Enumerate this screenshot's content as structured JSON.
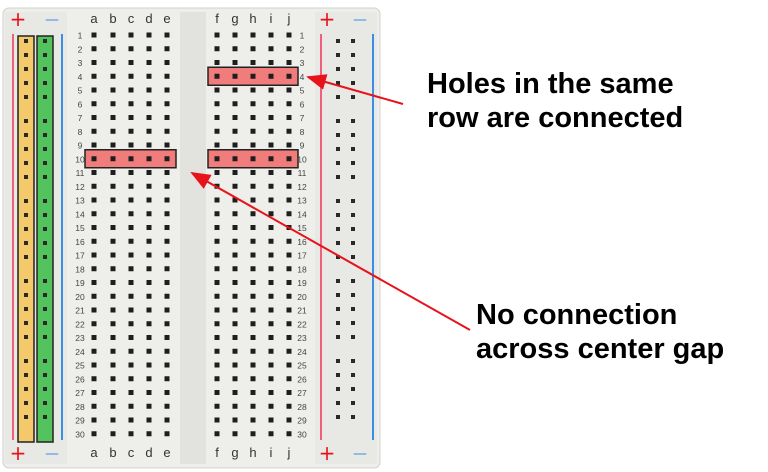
{
  "board": {
    "columns_left": [
      "a",
      "b",
      "c",
      "d",
      "e"
    ],
    "columns_right": [
      "f",
      "g",
      "h",
      "i",
      "j"
    ],
    "rows": 30,
    "rail_plus_symbol": "+",
    "rail_minus_symbol": "—"
  },
  "highlights": [
    {
      "id": "row-4-right",
      "side": "right",
      "row": 4
    },
    {
      "id": "row-10-left",
      "side": "left",
      "row": 10
    },
    {
      "id": "row-10-right",
      "side": "right",
      "row": 10
    }
  ],
  "rail_highlights": [
    {
      "id": "left-positive-rail",
      "color": "#f4c96b"
    },
    {
      "id": "left-negative-rail",
      "color": "#53c45d"
    }
  ],
  "annotations": {
    "connected": {
      "line1": "Holes in the same",
      "line2": "row are connected"
    },
    "gap": {
      "line1": "No connection",
      "line2": "across center gap"
    }
  },
  "colors": {
    "highlight_fill": "#f07c7c",
    "arrow": "#e8121b",
    "rail_red": "#f0607c",
    "rail_blue": "#3a8ee6"
  }
}
